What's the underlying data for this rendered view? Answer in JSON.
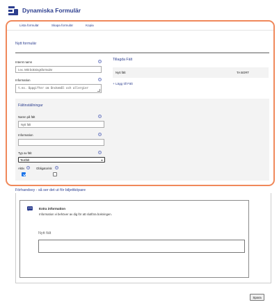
{
  "app": {
    "title": "Dynamiska Formulär",
    "brand_color": "#2c3e8f",
    "highlight_color": "#f0885a"
  },
  "tabs": [
    {
      "label": "Lista formulär",
      "active": false
    },
    {
      "label": "Skapa formulär",
      "active": true
    },
    {
      "label": "Kopia",
      "active": false
    }
  ],
  "form": {
    "title": "Nytt formulär",
    "internal_name_label": "Internt namn",
    "internal_name_placeholder": "t.ex. Mitt bokningsformulär",
    "information_label": "Information",
    "information_placeholder": "t.ex. Uppgifter om Onskemål och allergier"
  },
  "settings": {
    "title": "Fältinställningar",
    "field_name_label": "Namn på fält",
    "field_name_value": "Nytt fält",
    "information_label": "Information",
    "information_value": "",
    "field_type_label": "Typ av fält",
    "field_type_value": "Textfält",
    "active_label": "Aktiv",
    "active_checked": true,
    "required_label": "Obligatorisk",
    "required_checked": false
  },
  "added_fields": {
    "title": "Tillagda Fält",
    "items": [
      {
        "name": "Nytt fält",
        "remove_label": "TA BORT"
      }
    ],
    "add_label": "+ Lägg till Fält"
  },
  "preview": {
    "title": "Förhandsvy - så ser det ut för biljettköpare",
    "card_title": "Extra information",
    "card_description": "Information vi behöver av dig för att slutföra bokningen.",
    "field_label": "Nytt fält"
  },
  "actions": {
    "save_label": "Spara"
  },
  "icons": {
    "help": "?",
    "select_arrow": "▾"
  }
}
